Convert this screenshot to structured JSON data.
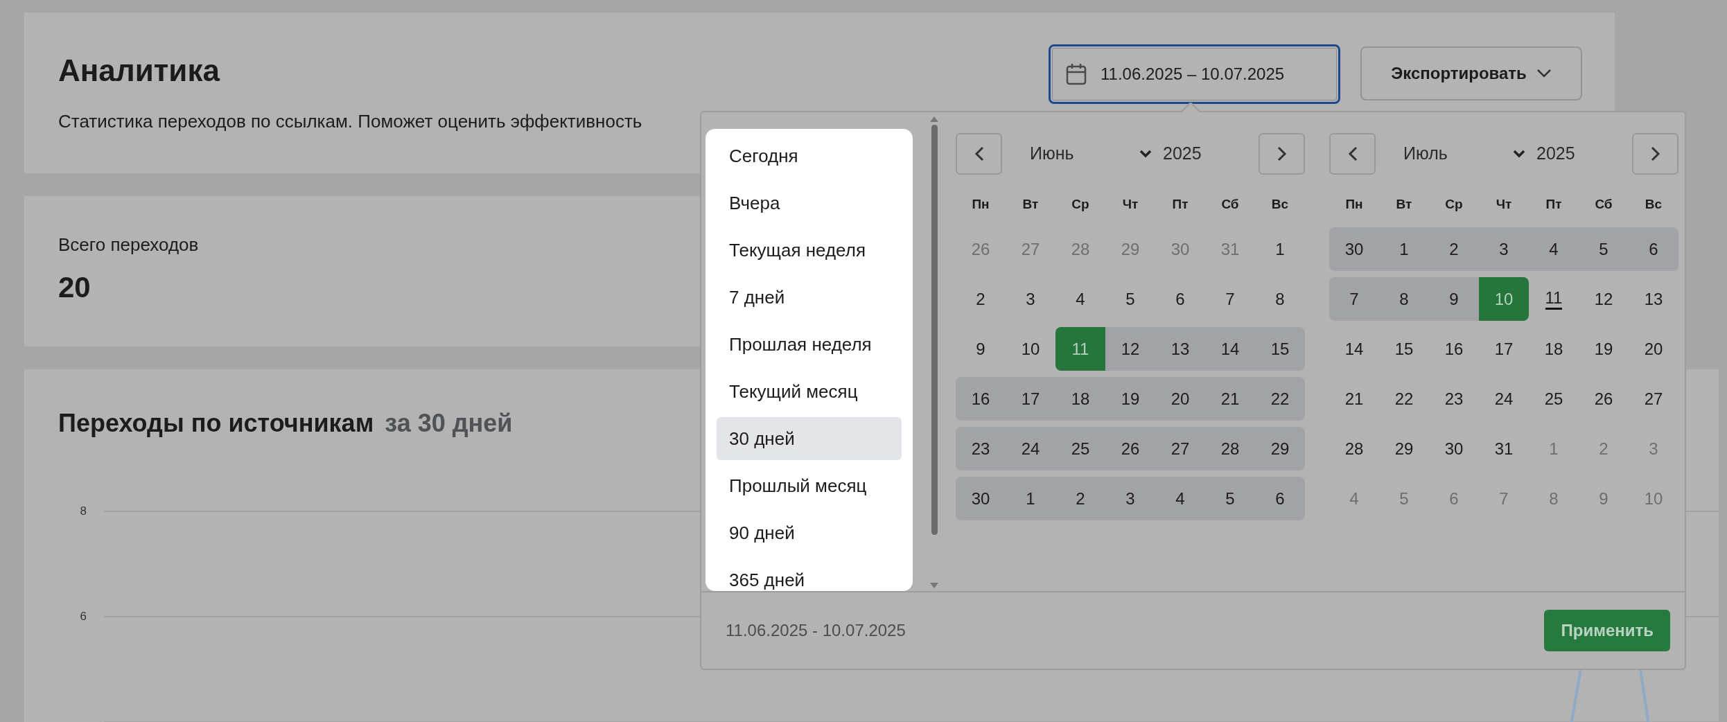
{
  "header": {
    "title": "Аналитика",
    "subtitle": "Статистика переходов по ссылкам. Поможет оценить эффективность",
    "date_range_button": "11.06.2025 – 10.07.2025",
    "export_button": "Экспортировать"
  },
  "stats": {
    "label": "Всего переходов",
    "value": "20"
  },
  "chart": {
    "title": "Переходы по источникам",
    "period": "за 30 дней",
    "y_ticks": [
      "8",
      "6"
    ]
  },
  "date_picker": {
    "presets": [
      {
        "label": "Сегодня",
        "selected": false
      },
      {
        "label": "Вчера",
        "selected": false
      },
      {
        "label": "Текущая неделя",
        "selected": false
      },
      {
        "label": "7 дней",
        "selected": false
      },
      {
        "label": "Прошлая неделя",
        "selected": false
      },
      {
        "label": "Текущий месяц",
        "selected": false
      },
      {
        "label": "30 дней",
        "selected": true
      },
      {
        "label": "Прошлый месяц",
        "selected": false
      },
      {
        "label": "90 дней",
        "selected": false
      },
      {
        "label": "365 дней",
        "selected": false
      }
    ],
    "months": [
      {
        "month": "Июнь",
        "year": "2025",
        "weekdays": [
          "Пн",
          "Вт",
          "Ср",
          "Чт",
          "Пт",
          "Сб",
          "Вс"
        ],
        "weeks": [
          [
            {
              "day": "26",
              "muted": true,
              "in_range": false,
              "selected": false,
              "today": false
            },
            {
              "day": "27",
              "muted": true,
              "in_range": false,
              "selected": false,
              "today": false
            },
            {
              "day": "28",
              "muted": true,
              "in_range": false,
              "selected": false,
              "today": false
            },
            {
              "day": "29",
              "muted": true,
              "in_range": false,
              "selected": false,
              "today": false
            },
            {
              "day": "30",
              "muted": true,
              "in_range": false,
              "selected": false,
              "today": false
            },
            {
              "day": "31",
              "muted": true,
              "in_range": false,
              "selected": false,
              "today": false
            },
            {
              "day": "1",
              "muted": false,
              "in_range": false,
              "selected": false,
              "today": false
            }
          ],
          [
            {
              "day": "2",
              "muted": false,
              "in_range": false,
              "selected": false,
              "today": false
            },
            {
              "day": "3",
              "muted": false,
              "in_range": false,
              "selected": false,
              "today": false
            },
            {
              "day": "4",
              "muted": false,
              "in_range": false,
              "selected": false,
              "today": false
            },
            {
              "day": "5",
              "muted": false,
              "in_range": false,
              "selected": false,
              "today": false
            },
            {
              "day": "6",
              "muted": false,
              "in_range": false,
              "selected": false,
              "today": false
            },
            {
              "day": "7",
              "muted": false,
              "in_range": false,
              "selected": false,
              "today": false
            },
            {
              "day": "8",
              "muted": false,
              "in_range": false,
              "selected": false,
              "today": false
            }
          ],
          [
            {
              "day": "9",
              "muted": false,
              "in_range": false,
              "selected": false,
              "today": false
            },
            {
              "day": "10",
              "muted": false,
              "in_range": false,
              "selected": false,
              "today": false
            },
            {
              "day": "11",
              "muted": false,
              "in_range": true,
              "selected": true,
              "today": false
            },
            {
              "day": "12",
              "muted": false,
              "in_range": true,
              "selected": false,
              "today": false
            },
            {
              "day": "13",
              "muted": false,
              "in_range": true,
              "selected": false,
              "today": false
            },
            {
              "day": "14",
              "muted": false,
              "in_range": true,
              "selected": false,
              "today": false
            },
            {
              "day": "15",
              "muted": false,
              "in_range": true,
              "selected": false,
              "today": false
            }
          ],
          [
            {
              "day": "16",
              "muted": false,
              "in_range": true,
              "selected": false,
              "today": false
            },
            {
              "day": "17",
              "muted": false,
              "in_range": true,
              "selected": false,
              "today": false
            },
            {
              "day": "18",
              "muted": false,
              "in_range": true,
              "selected": false,
              "today": false
            },
            {
              "day": "19",
              "muted": false,
              "in_range": true,
              "selected": false,
              "today": false
            },
            {
              "day": "20",
              "muted": false,
              "in_range": true,
              "selected": false,
              "today": false
            },
            {
              "day": "21",
              "muted": false,
              "in_range": true,
              "selected": false,
              "today": false
            },
            {
              "day": "22",
              "muted": false,
              "in_range": true,
              "selected": false,
              "today": false
            }
          ],
          [
            {
              "day": "23",
              "muted": false,
              "in_range": true,
              "selected": false,
              "today": false
            },
            {
              "day": "24",
              "muted": false,
              "in_range": true,
              "selected": false,
              "today": false
            },
            {
              "day": "25",
              "muted": false,
              "in_range": true,
              "selected": false,
              "today": false
            },
            {
              "day": "26",
              "muted": false,
              "in_range": true,
              "selected": false,
              "today": false
            },
            {
              "day": "27",
              "muted": false,
              "in_range": true,
              "selected": false,
              "today": false
            },
            {
              "day": "28",
              "muted": false,
              "in_range": true,
              "selected": false,
              "today": false
            },
            {
              "day": "29",
              "muted": false,
              "in_range": true,
              "selected": false,
              "today": false
            }
          ],
          [
            {
              "day": "30",
              "muted": false,
              "in_range": true,
              "selected": false,
              "today": false
            },
            {
              "day": "1",
              "muted": false,
              "in_range": true,
              "selected": false,
              "today": false
            },
            {
              "day": "2",
              "muted": false,
              "in_range": true,
              "selected": false,
              "today": false
            },
            {
              "day": "3",
              "muted": false,
              "in_range": true,
              "selected": false,
              "today": false
            },
            {
              "day": "4",
              "muted": false,
              "in_range": true,
              "selected": false,
              "today": false
            },
            {
              "day": "5",
              "muted": false,
              "in_range": true,
              "selected": false,
              "today": false
            },
            {
              "day": "6",
              "muted": false,
              "in_range": true,
              "selected": false,
              "today": false
            }
          ]
        ]
      },
      {
        "month": "Июль",
        "year": "2025",
        "weekdays": [
          "Пн",
          "Вт",
          "Ср",
          "Чт",
          "Пт",
          "Сб",
          "Вс"
        ],
        "weeks": [
          [
            {
              "day": "30",
              "muted": false,
              "in_range": true,
              "selected": false,
              "today": false
            },
            {
              "day": "1",
              "muted": false,
              "in_range": true,
              "selected": false,
              "today": false
            },
            {
              "day": "2",
              "muted": false,
              "in_range": true,
              "selected": false,
              "today": false
            },
            {
              "day": "3",
              "muted": false,
              "in_range": true,
              "selected": false,
              "today": false
            },
            {
              "day": "4",
              "muted": false,
              "in_range": true,
              "selected": false,
              "today": false
            },
            {
              "day": "5",
              "muted": false,
              "in_range": true,
              "selected": false,
              "today": false
            },
            {
              "day": "6",
              "muted": false,
              "in_range": true,
              "selected": false,
              "today": false
            }
          ],
          [
            {
              "day": "7",
              "muted": false,
              "in_range": true,
              "selected": false,
              "today": false
            },
            {
              "day": "8",
              "muted": false,
              "in_range": true,
              "selected": false,
              "today": false
            },
            {
              "day": "9",
              "muted": false,
              "in_range": true,
              "selected": false,
              "today": false
            },
            {
              "day": "10",
              "muted": false,
              "in_range": true,
              "selected": true,
              "today": false
            },
            {
              "day": "11",
              "muted": false,
              "in_range": false,
              "selected": false,
              "today": true
            },
            {
              "day": "12",
              "muted": false,
              "in_range": false,
              "selected": false,
              "today": false
            },
            {
              "day": "13",
              "muted": false,
              "in_range": false,
              "selected": false,
              "today": false
            }
          ],
          [
            {
              "day": "14",
              "muted": false,
              "in_range": false,
              "selected": false,
              "today": false
            },
            {
              "day": "15",
              "muted": false,
              "in_range": false,
              "selected": false,
              "today": false
            },
            {
              "day": "16",
              "muted": false,
              "in_range": false,
              "selected": false,
              "today": false
            },
            {
              "day": "17",
              "muted": false,
              "in_range": false,
              "selected": false,
              "today": false
            },
            {
              "day": "18",
              "muted": false,
              "in_range": false,
              "selected": false,
              "today": false
            },
            {
              "day": "19",
              "muted": false,
              "in_range": false,
              "selected": false,
              "today": false
            },
            {
              "day": "20",
              "muted": false,
              "in_range": false,
              "selected": false,
              "today": false
            }
          ],
          [
            {
              "day": "21",
              "muted": false,
              "in_range": false,
              "selected": false,
              "today": false
            },
            {
              "day": "22",
              "muted": false,
              "in_range": false,
              "selected": false,
              "today": false
            },
            {
              "day": "23",
              "muted": false,
              "in_range": false,
              "selected": false,
              "today": false
            },
            {
              "day": "24",
              "muted": false,
              "in_range": false,
              "selected": false,
              "today": false
            },
            {
              "day": "25",
              "muted": false,
              "in_range": false,
              "selected": false,
              "today": false
            },
            {
              "day": "26",
              "muted": false,
              "in_range": false,
              "selected": false,
              "today": false
            },
            {
              "day": "27",
              "muted": false,
              "in_range": false,
              "selected": false,
              "today": false
            }
          ],
          [
            {
              "day": "28",
              "muted": false,
              "in_range": false,
              "selected": false,
              "today": false
            },
            {
              "day": "29",
              "muted": false,
              "in_range": false,
              "selected": false,
              "today": false
            },
            {
              "day": "30",
              "muted": false,
              "in_range": false,
              "selected": false,
              "today": false
            },
            {
              "day": "31",
              "muted": false,
              "in_range": false,
              "selected": false,
              "today": false
            },
            {
              "day": "1",
              "muted": true,
              "in_range": false,
              "selected": false,
              "today": false
            },
            {
              "day": "2",
              "muted": true,
              "in_range": false,
              "selected": false,
              "today": false
            },
            {
              "day": "3",
              "muted": true,
              "in_range": false,
              "selected": false,
              "today": false
            }
          ],
          [
            {
              "day": "4",
              "muted": true,
              "in_range": false,
              "selected": false,
              "today": false
            },
            {
              "day": "5",
              "muted": true,
              "in_range": false,
              "selected": false,
              "today": false
            },
            {
              "day": "6",
              "muted": true,
              "in_range": false,
              "selected": false,
              "today": false
            },
            {
              "day": "7",
              "muted": true,
              "in_range": false,
              "selected": false,
              "today": false
            },
            {
              "day": "8",
              "muted": true,
              "in_range": false,
              "selected": false,
              "today": false
            },
            {
              "day": "9",
              "muted": true,
              "in_range": false,
              "selected": false,
              "today": false
            },
            {
              "day": "10",
              "muted": true,
              "in_range": false,
              "selected": false,
              "today": false
            }
          ]
        ]
      }
    ],
    "footer_range": "11.06.2025 - 10.07.2025",
    "apply_button": "Применить"
  }
}
